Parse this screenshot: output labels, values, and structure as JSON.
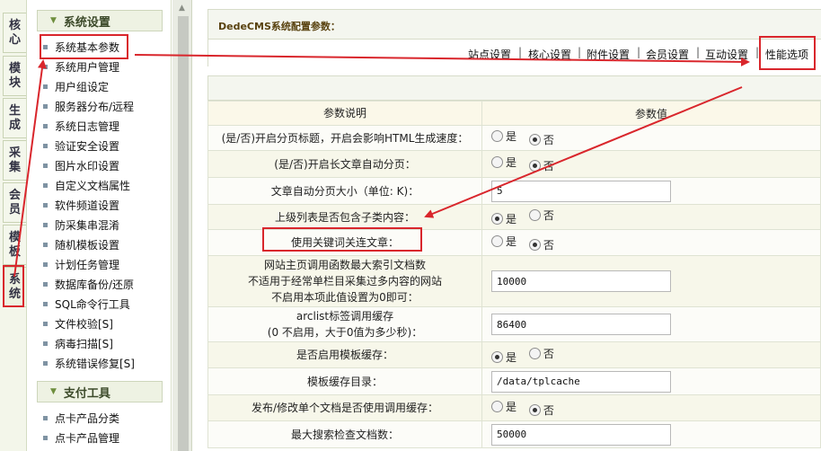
{
  "vtabs": [
    {
      "label": [
        "核",
        "心"
      ]
    },
    {
      "label": [
        "模",
        "块"
      ]
    },
    {
      "label": [
        "生",
        "成"
      ]
    },
    {
      "label": [
        "采",
        "集"
      ]
    },
    {
      "label": [
        "会",
        "员"
      ]
    },
    {
      "label": [
        "模",
        "板"
      ]
    },
    {
      "label": [
        "系",
        "统"
      ]
    }
  ],
  "sidebar": {
    "section1": "系统设置",
    "items": [
      "系统基本参数",
      "系统用户管理",
      "用户组设定",
      "服务器分布/远程",
      "系统日志管理",
      "验证安全设置",
      "图片水印设置",
      "自定义文档属性",
      "软件频道设置",
      "防采集串混淆",
      "随机模板设置",
      "计划任务管理",
      "数据库备份/还原",
      "SQL命令行工具",
      "文件校验[S]",
      "病毒扫描[S]",
      "系统错误修复[S]"
    ],
    "section2": "支付工具",
    "items2": [
      "点卡产品分类",
      "点卡产品管理"
    ]
  },
  "main": {
    "title": "DedeCMS系统配置参数：",
    "tabs": [
      "站点设置",
      "核心设置",
      "附件设置",
      "会员设置",
      "互动设置",
      "性能选项"
    ],
    "separator": "|",
    "col_desc": "参数说明",
    "col_value": "参数值",
    "yes": "是",
    "no": "否",
    "rows": [
      {
        "label": "(是/否)开启分页标题，开启会影响HTML生成速度：",
        "type": "radio",
        "selected": "no"
      },
      {
        "label": "(是/否)开启长文章自动分页：",
        "type": "radio",
        "selected": "no"
      },
      {
        "label": "文章自动分页大小（单位: K)：",
        "type": "text",
        "value": "5"
      },
      {
        "label": "上级列表是否包含子类内容：",
        "type": "radio",
        "selected": "yes"
      },
      {
        "label": "使用关键词关连文章：",
        "type": "radio",
        "selected": "no"
      },
      {
        "label_lines": [
          "网站主页调用函数最大索引文档数",
          "不适用于经常单栏目采集过多内容的网站",
          "不启用本项此值设置为0即可："
        ],
        "type": "text",
        "value": "10000"
      },
      {
        "label_lines": [
          "arclist标签调用缓存",
          "(0 不启用，大于0值为多少秒)："
        ],
        "type": "text",
        "value": "86400"
      },
      {
        "label": "是否启用模板缓存：",
        "type": "radio",
        "selected": "yes"
      },
      {
        "label": "模板缓存目录：",
        "type": "text",
        "value": "/data/tplcache"
      },
      {
        "label": "发布/修改单个文档是否使用调用缓存：",
        "type": "radio",
        "selected": "no"
      },
      {
        "label": "最大搜索检查文档数：",
        "type": "text",
        "value": "50000"
      }
    ]
  },
  "annotation_color": "#d9262c"
}
